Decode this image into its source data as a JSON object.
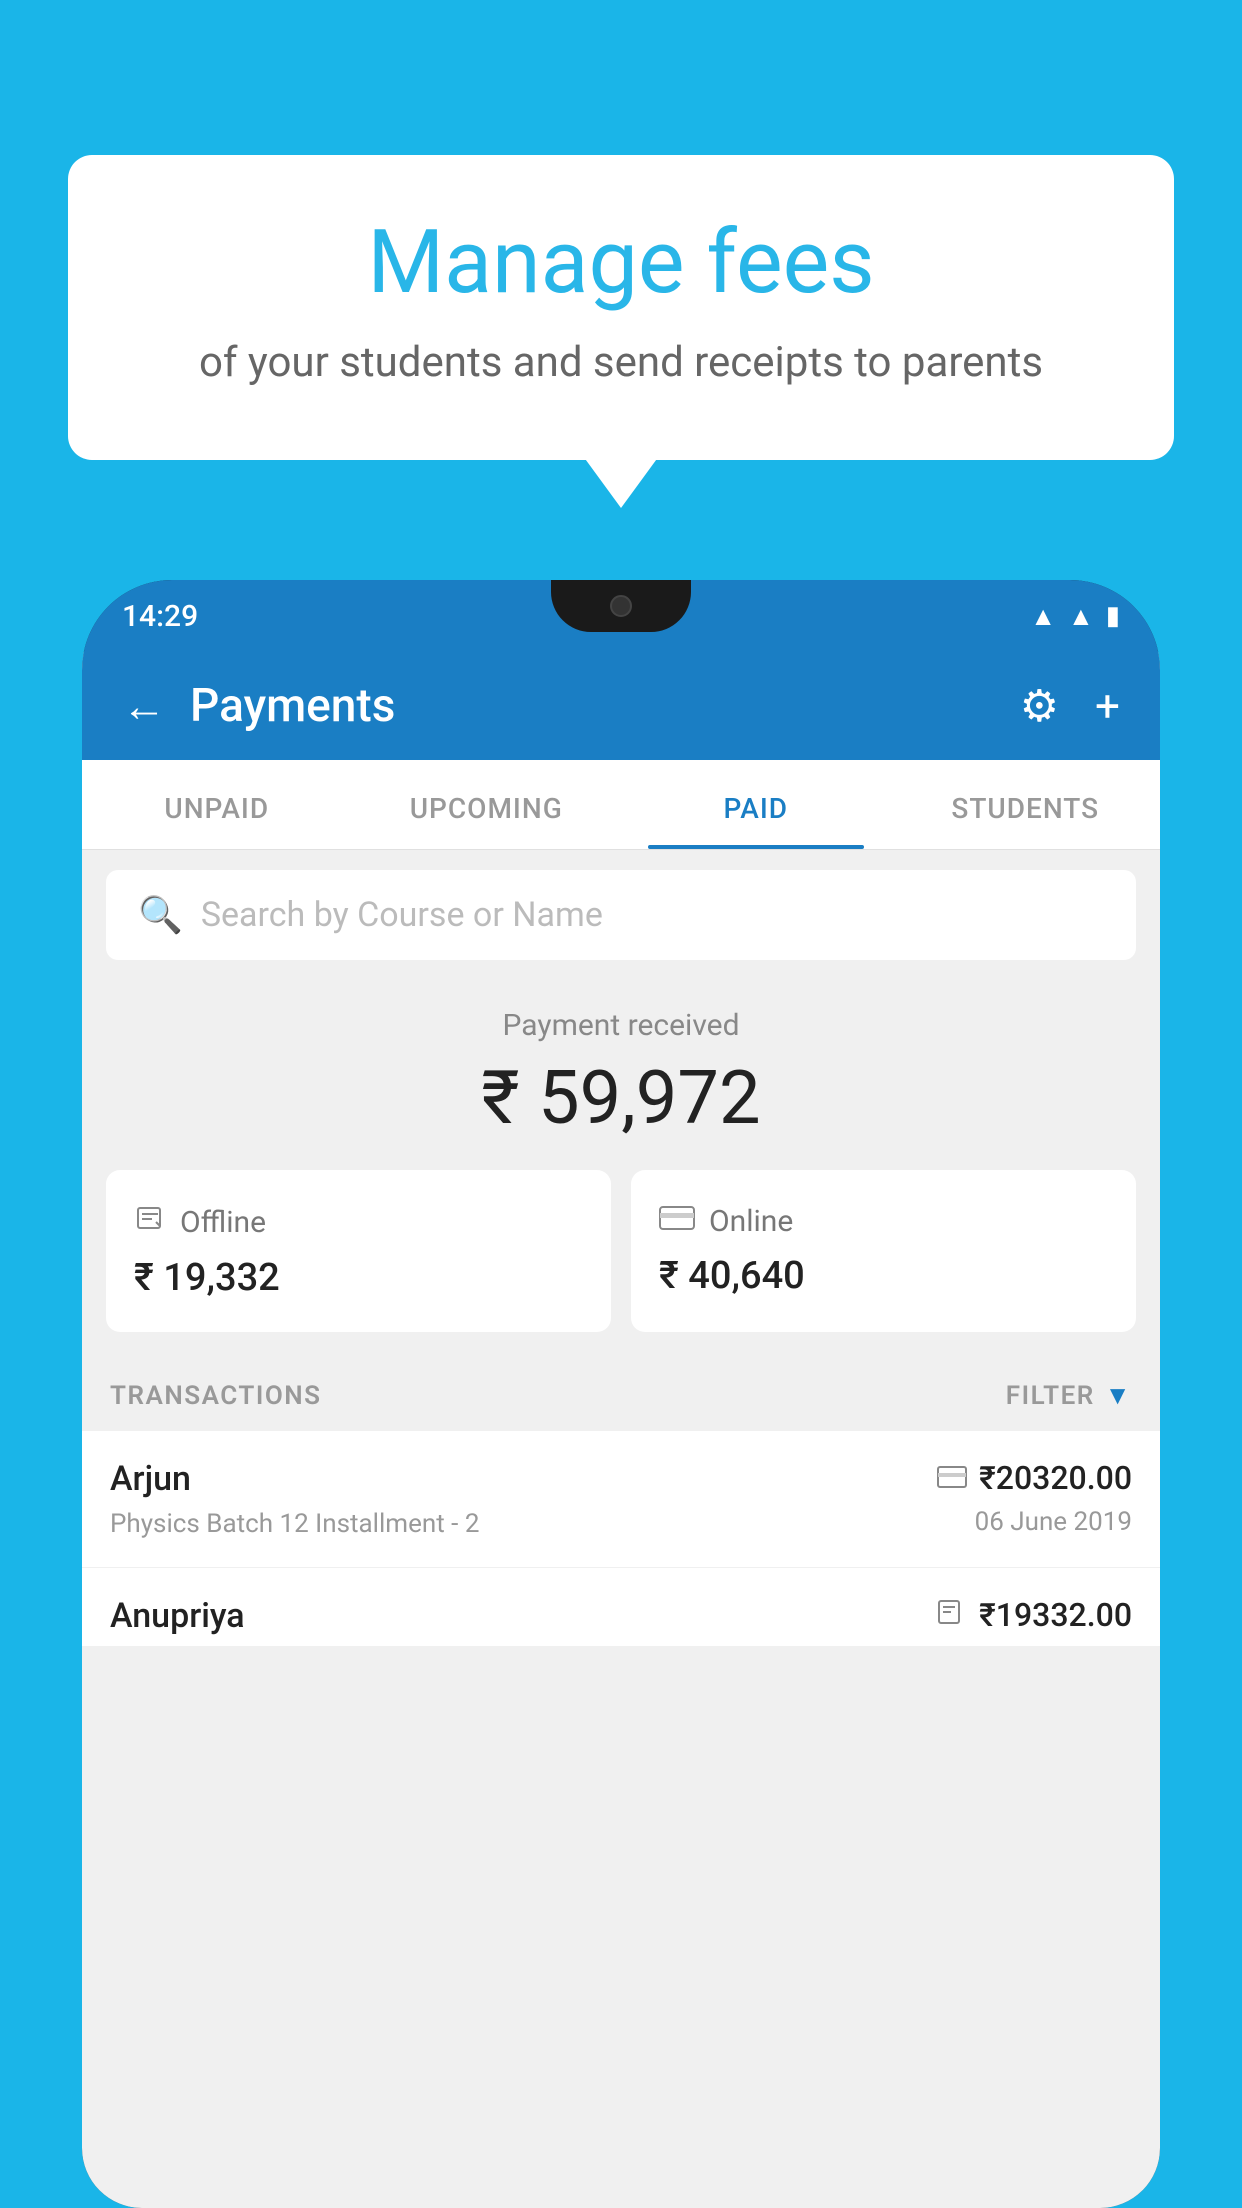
{
  "background_color": "#1ab5e8",
  "bubble": {
    "title": "Manage fees",
    "subtitle": "of your students and send receipts to parents"
  },
  "phone": {
    "status_bar": {
      "time": "14:29"
    },
    "header": {
      "title": "Payments",
      "back_label": "←",
      "settings_label": "⚙",
      "add_label": "+"
    },
    "tabs": [
      {
        "id": "unpaid",
        "label": "UNPAID",
        "active": false
      },
      {
        "id": "upcoming",
        "label": "UPCOMING",
        "active": false
      },
      {
        "id": "paid",
        "label": "PAID",
        "active": true
      },
      {
        "id": "students",
        "label": "STUDENTS",
        "active": false
      }
    ],
    "search": {
      "placeholder": "Search by Course or Name"
    },
    "payment_received": {
      "label": "Payment received",
      "amount": "₹ 59,972"
    },
    "payment_cards": [
      {
        "type": "Offline",
        "amount": "₹ 19,332",
        "icon": "💳"
      },
      {
        "type": "Online",
        "amount": "₹ 40,640",
        "icon": "💳"
      }
    ],
    "transactions_section": {
      "label": "TRANSACTIONS",
      "filter_label": "FILTER"
    },
    "transactions": [
      {
        "name": "Arjun",
        "detail": "Physics Batch 12 Installment - 2",
        "amount": "₹20320.00",
        "date": "06 June 2019",
        "pay_type": "online"
      },
      {
        "name": "Anupriya",
        "detail": "",
        "amount": "₹19332.00",
        "date": "",
        "pay_type": "offline"
      }
    ]
  }
}
